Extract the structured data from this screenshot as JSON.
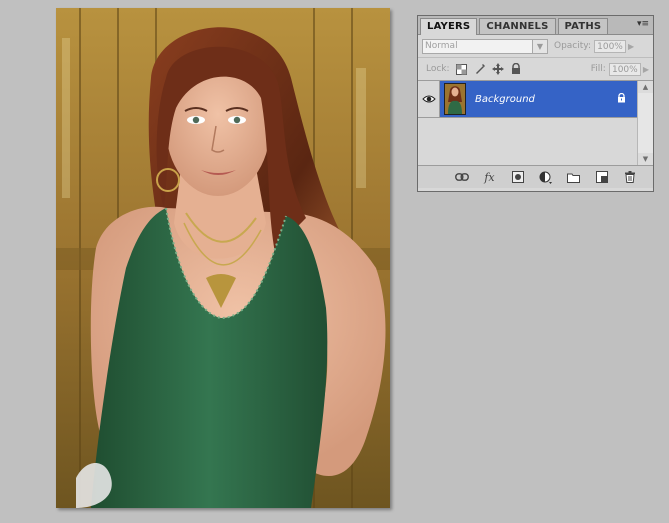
{
  "panel": {
    "tabs": [
      {
        "label": "LAYERS",
        "active": true
      },
      {
        "label": "CHANNELS",
        "active": false
      },
      {
        "label": "PATHS",
        "active": false
      }
    ],
    "menu_glyph": "▾≡",
    "blend_mode": "Normal",
    "opacity_label": "Opacity:",
    "opacity_value": "100%",
    "lock_label": "Lock:",
    "fill_label": "Fill:",
    "fill_value": "100%",
    "layers": [
      {
        "name": "Background",
        "visible": true,
        "locked": true,
        "selected": true
      }
    ],
    "footer_icons": [
      "link-layers-icon",
      "fx-icon",
      "layer-mask-icon",
      "adjustment-layer-icon",
      "new-group-icon",
      "new-layer-icon",
      "trash-icon"
    ]
  },
  "colors": {
    "workspace": "#c0c0c0",
    "selection": "#3563c6",
    "shirt_green": "#2f6a45",
    "hair": "#6e2e18",
    "fence": "#a07a32"
  },
  "document": {
    "subject": "portrait-photo"
  }
}
